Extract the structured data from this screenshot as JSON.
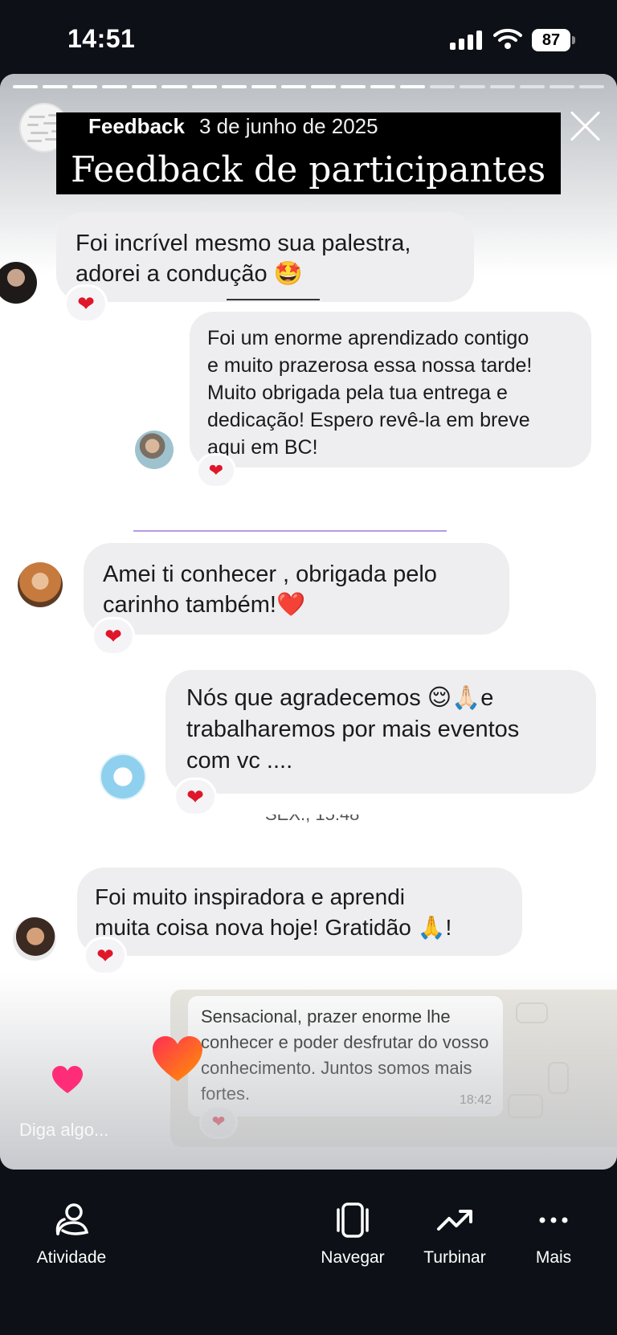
{
  "status_bar": {
    "time": "14:51",
    "battery": "87"
  },
  "story": {
    "author": "Feedback",
    "date": "3 de junho de 2025",
    "title": "Feedback de participantes",
    "progress_segments": 20,
    "progress_done": 14,
    "messages": [
      {
        "side": "left",
        "text": "Foi incrível mesmo sua palestra,\nadorei a condução",
        "emoji": "🤩",
        "reaction": "❤"
      },
      {
        "side": "right",
        "text": "Foi um enorme aprendizado contigo\ne muito prazerosa essa nossa tarde!\nMuito obrigada pela tua entrega e\ndedicação! Espero revê-la em breve\naqui em BC!",
        "reaction": "❤"
      },
      {
        "side": "left",
        "text": "Amei ti conhecer , obrigada pelo\ncarinho também!",
        "emoji": "❤️",
        "reaction": "❤"
      },
      {
        "side": "right",
        "text_line1": "Nós que agradecemos",
        "emoji1": "😌",
        "emoji2": "🙏🏻",
        "text_line1_end": "e",
        "text_rest": "trabalharemos por mais eventos\ncom vc ....",
        "reaction": "❤"
      },
      {
        "side": "left",
        "text_line1": "Foi muito inspiradora e aprendi",
        "text_line2": "muita coisa nova hoje! Gratidão",
        "emoji": "🙏",
        "text_end": "!",
        "reaction": "❤"
      }
    ],
    "timestamp_fragment": "SEX., 15:48",
    "whatsapp": {
      "text": "Sensacional, prazer enorme lhe\nconhecer e poder desfrutar do\nvosso conhecimento. Juntos\nsomos mais fortes.",
      "time": "18:42",
      "reaction": "❤"
    },
    "reply_placeholder": "Diga algo..."
  },
  "bottom_nav": [
    {
      "label": "Atividade",
      "icon": "activity-icon"
    },
    {
      "label": "Navegar",
      "icon": "browse-icon"
    },
    {
      "label": "Turbinar",
      "icon": "boost-icon"
    },
    {
      "label": "Mais",
      "icon": "more-icon"
    }
  ]
}
